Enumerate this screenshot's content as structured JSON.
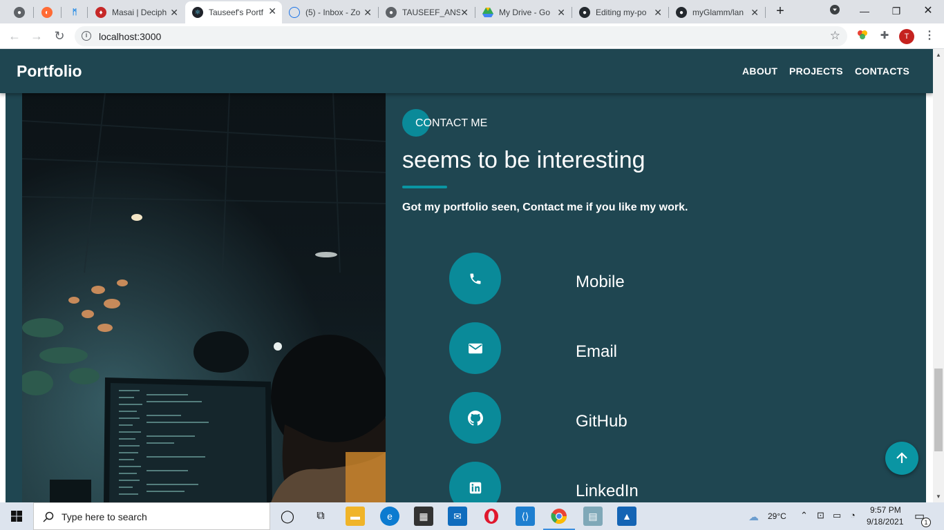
{
  "browser": {
    "tabs": [
      {
        "title": "",
        "color": "#5f6368"
      },
      {
        "title": "",
        "color": "#ff6b35"
      },
      {
        "title": "",
        "color": "#1e88e5"
      },
      {
        "title": "Masai | Deciph",
        "color": "#c62828"
      },
      {
        "title": "Tauseef's Portf",
        "color": "#61dafb",
        "active": true
      },
      {
        "title": "(5) - Inbox - Zo",
        "color": "#1a73e8"
      },
      {
        "title": "TAUSEEF_ANS",
        "color": "#5f6368"
      },
      {
        "title": "My Drive - Go",
        "color": "#34a853"
      },
      {
        "title": "Editing my-po",
        "color": "#24292e"
      },
      {
        "title": "myGlamm/lan",
        "color": "#24292e"
      }
    ],
    "new_tab_label": "+",
    "url": "localhost:3000",
    "profile_initial": "T"
  },
  "site": {
    "brand": "Portfolio",
    "nav": [
      "ABOUT",
      "PROJECTS",
      "CONTACTS"
    ],
    "section_badge": "CONTACT ME",
    "headline": "seems to be interesting",
    "subtext": "Got my portfolio seen, Contact me if you like my work.",
    "contacts": [
      {
        "label": "Mobile",
        "icon": "phone-icon"
      },
      {
        "label": "Email",
        "icon": "mail-icon"
      },
      {
        "label": "GitHub",
        "icon": "github-icon"
      },
      {
        "label": "LinkedIn",
        "icon": "linkedin-icon"
      }
    ],
    "colors": {
      "background": "#1f4651",
      "accent": "#0a8a99"
    }
  },
  "taskbar": {
    "search_placeholder": "Type here to search",
    "temperature": "29°C",
    "time": "9:57 PM",
    "date": "9/18/2021",
    "notification_count": "1"
  }
}
